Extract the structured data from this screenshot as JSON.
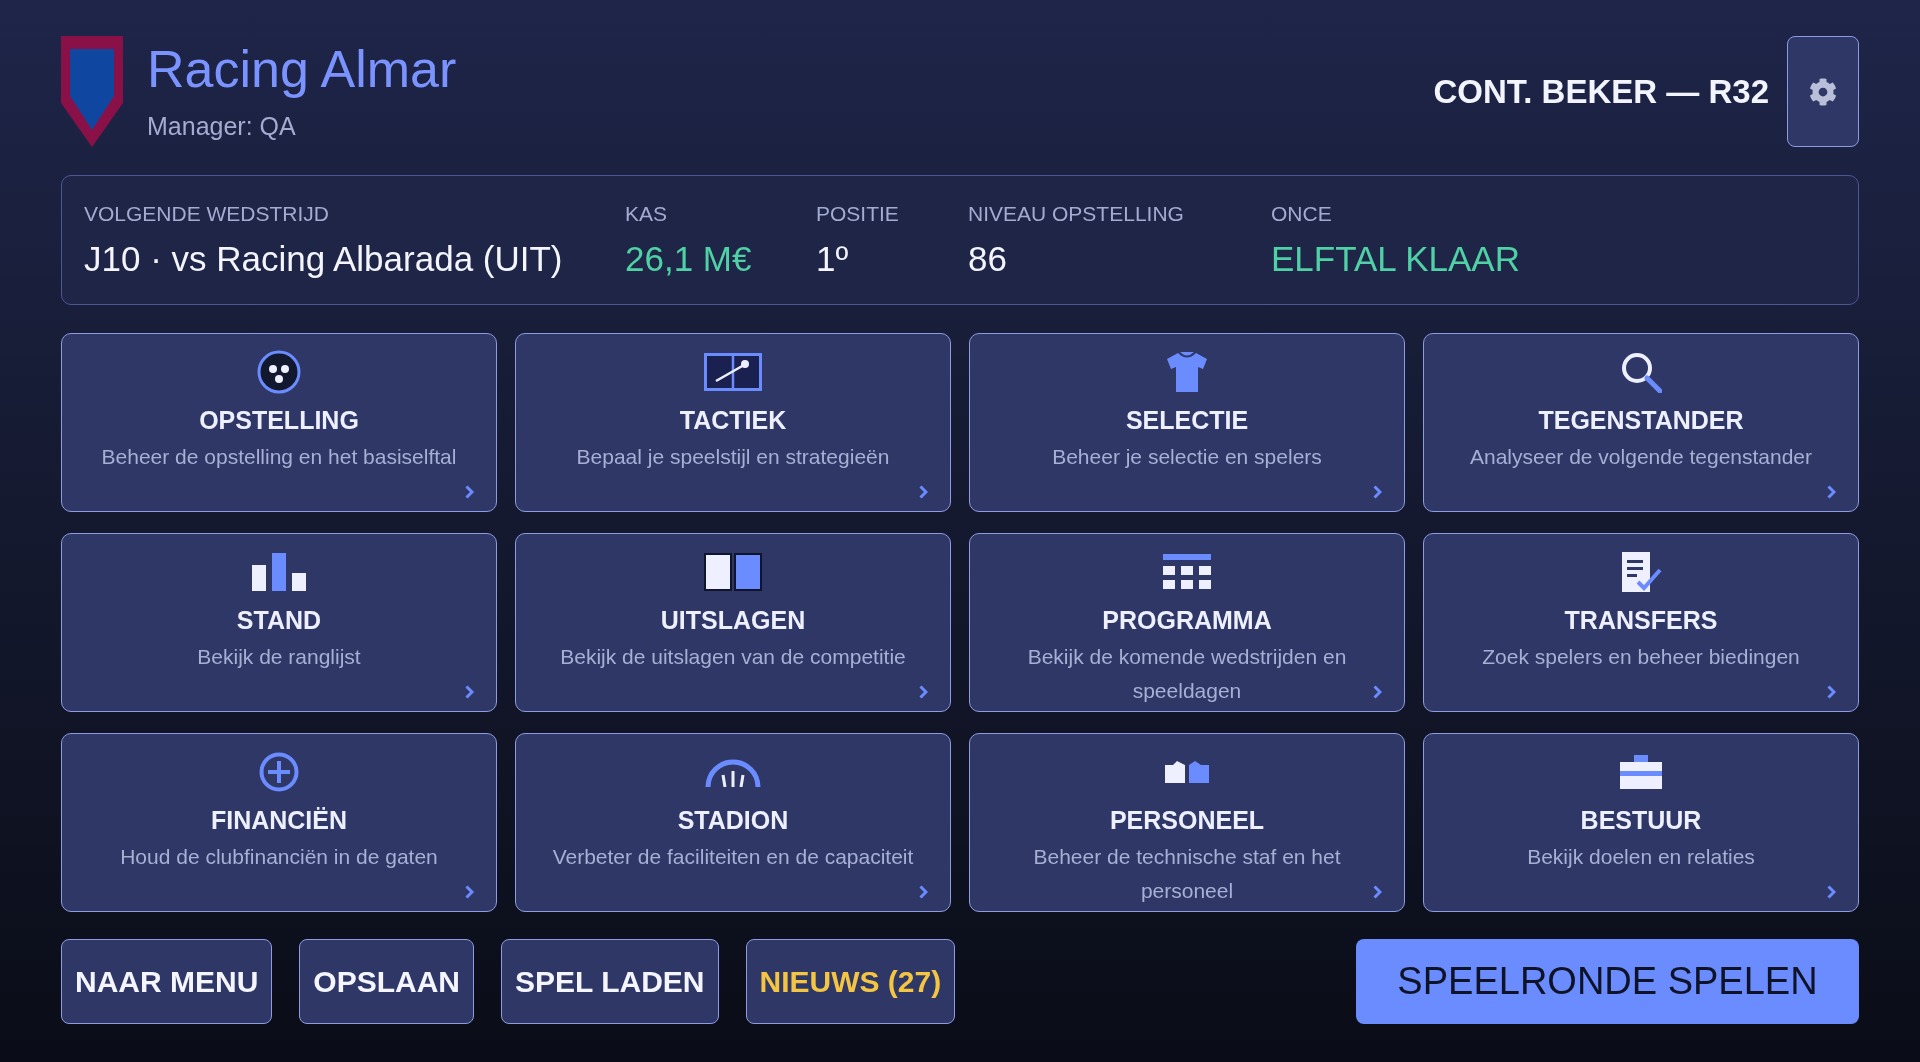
{
  "header": {
    "club_name": "Racing Almar",
    "manager": "Manager: QA",
    "competition": "CONT. BEKER — R32"
  },
  "summary": [
    {
      "label": "VOLGENDE WEDSTRIJD",
      "value": "J10 · vs Racing Albarada (UIT)",
      "highlighted": false
    },
    {
      "label": "KAS",
      "value": "26,1 M€",
      "highlighted": true
    },
    {
      "label": "POSITIE",
      "value": "1º",
      "highlighted": false
    },
    {
      "label": "NIVEAU OPSTELLING",
      "value": "86",
      "highlighted": false
    },
    {
      "label": "ONCE",
      "value": "ELFTAL KLAAR",
      "highlighted": true
    }
  ],
  "menu_cards": [
    {
      "title": "OPSTELLING",
      "description": "Beheer de opstelling en het basiselftal"
    },
    {
      "title": "TACTIEK",
      "description": "Bepaal je speelstijl en strategieën"
    },
    {
      "title": "SELECTIE",
      "description": "Beheer je selectie en spelers"
    },
    {
      "title": "TEGENSTANDER",
      "description": "Analyseer de volgende tegenstander"
    },
    {
      "title": "STAND",
      "description": "Bekijk de ranglijst"
    },
    {
      "title": "UITSLAGEN",
      "description": "Bekijk de uitslagen van de competitie"
    },
    {
      "title": "PROGRAMMA",
      "description": "Bekijk de komende wedstrijden en speeldagen"
    },
    {
      "title": "TRANSFERS",
      "description": "Zoek spelers en beheer biedingen"
    },
    {
      "title": "FINANCIËN",
      "description": "Houd de clubfinanciën in de gaten"
    },
    {
      "title": "STADION",
      "description": "Verbeter de faciliteiten en de capaciteit"
    },
    {
      "title": "PERSONEEL",
      "description": "Beheer de technische staf en het personeel"
    },
    {
      "title": "BESTUUR",
      "description": "Bekijk doelen en relaties"
    }
  ],
  "footer_buttons": [
    {
      "label": "NAAR MENU",
      "highlighted": false
    },
    {
      "label": "OPSLAAN",
      "highlighted": false
    },
    {
      "label": "SPEL LADEN",
      "highlighted": false
    },
    {
      "label": "NIEUWS (27)",
      "highlighted": true
    }
  ],
  "primary_button": {
    "label": "SPEELRONDE SPELEN"
  }
}
